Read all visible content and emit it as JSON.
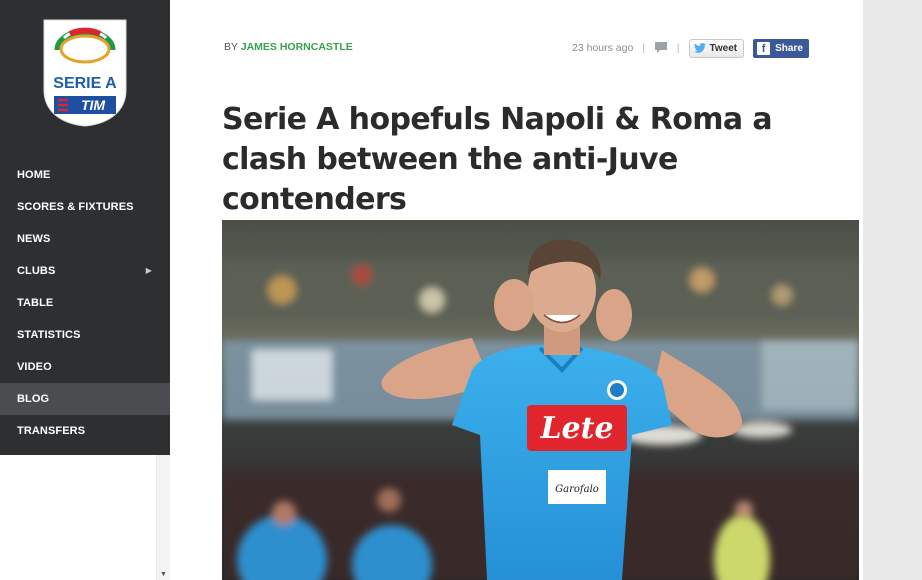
{
  "sidebar": {
    "logo": {
      "line1": "SERIE A",
      "line2": "TIM"
    },
    "items": [
      {
        "label": "HOME"
      },
      {
        "label": "SCORES & FIXTURES"
      },
      {
        "label": "NEWS"
      },
      {
        "label": "CLUBS",
        "has_submenu": true
      },
      {
        "label": "TABLE"
      },
      {
        "label": "STATISTICS"
      },
      {
        "label": "VIDEO"
      },
      {
        "label": "BLOG",
        "active": true
      },
      {
        "label": "TRANSFERS"
      }
    ]
  },
  "article": {
    "byline_prefix": "BY",
    "author": "JAMES HORNCASTLE",
    "timestamp": "23 hours ago",
    "tweet_label": "Tweet",
    "share_label": "Share",
    "headline": "Serie A hopefuls Napoli & Roma a clash between the anti-Juve contenders",
    "hero": {
      "shirt_sponsor": "Lete",
      "shirt_sub_sponsor": "Garofalo"
    }
  },
  "colors": {
    "sidebar_bg": "#2d2f31",
    "sidebar_active": "#4a4c4f",
    "author_green": "#3aa04a",
    "facebook_blue": "#3b5998",
    "napoli_blue": "#2ba0e0"
  },
  "icons": {
    "comment": "comment-icon",
    "twitter": "twitter-bird-icon",
    "facebook": "facebook-icon",
    "submenu": "chevron-right-icon",
    "scroll_down": "arrow-down-icon"
  }
}
